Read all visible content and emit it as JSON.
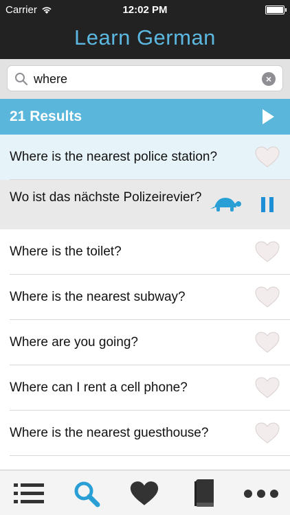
{
  "status": {
    "carrier": "Carrier",
    "time": "12:02 PM",
    "wifi_icon": "wifi-icon",
    "battery_icon": "battery-icon"
  },
  "nav": {
    "title": "Learn German"
  },
  "search": {
    "value": "where",
    "icon": "search-icon",
    "clear_icon": "clear-icon"
  },
  "results": {
    "label": "21 Results",
    "play_icon": "play-icon"
  },
  "list": {
    "items": [
      {
        "text": "Where is the nearest police station?",
        "state": "selected"
      },
      {
        "text": "Wo ist das nächste Polizeirevier?",
        "state": "translation"
      },
      {
        "text": "Where is the toilet?"
      },
      {
        "text": "Where is the nearest subway?"
      },
      {
        "text": "Where are you going?"
      },
      {
        "text": "Where can I rent a cell phone?"
      },
      {
        "text": "Where is the nearest guesthouse?"
      }
    ]
  },
  "tabs": [
    {
      "name": "list",
      "icon": "list-icon",
      "active": false
    },
    {
      "name": "search",
      "icon": "search-icon",
      "active": true
    },
    {
      "name": "favorites",
      "icon": "heart-icon",
      "active": false
    },
    {
      "name": "book",
      "icon": "book-icon",
      "active": false
    },
    {
      "name": "more",
      "icon": "more-icon",
      "active": false
    }
  ],
  "colors": {
    "accent": "#5ab6db",
    "dark_bar": "#222222",
    "title": "#5cb8e0",
    "active_tab": "#2a9fd6",
    "inactive_tab": "#333333",
    "heart": "#f3ecec"
  }
}
